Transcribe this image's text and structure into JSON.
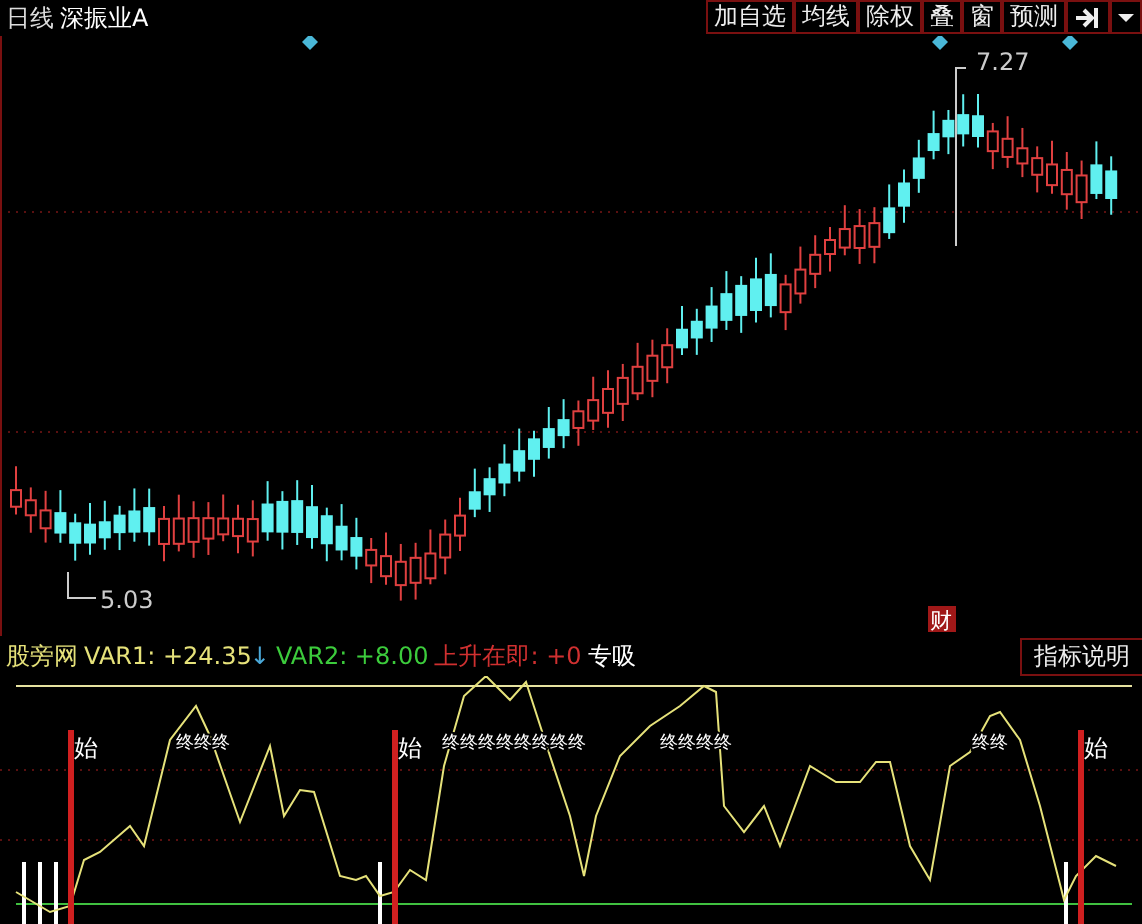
{
  "header": {
    "period": "日线",
    "stock_name": "深振业A"
  },
  "toolbar": [
    {
      "label": "加自选"
    },
    {
      "label": "均线"
    },
    {
      "label": "除权"
    },
    {
      "label": "叠"
    },
    {
      "label": "窗"
    },
    {
      "label": "预测"
    }
  ],
  "price_chart": {
    "high_label": "7.27",
    "low_label": "5.03",
    "event_badge": "财"
  },
  "indicator": {
    "name": "股旁网",
    "explain_button": "指标说明",
    "values": [
      {
        "text": "VAR1: +24.35",
        "color": "#e6e27a"
      },
      {
        "text": "↓",
        "color": "#4aa8d8"
      },
      {
        "text": "VAR2: +8.00",
        "color": "#3ccc3c"
      },
      {
        "text": "上升在即: +0",
        "color": "#d03030"
      },
      {
        "text": "专吸",
        "color": "#ffffff"
      }
    ]
  },
  "signals": [
    {
      "kind": "start",
      "text": "始"
    },
    {
      "kind": "end",
      "text": "终终终"
    },
    {
      "kind": "start",
      "text": "始"
    },
    {
      "kind": "end",
      "text": "终终终终终终终终"
    },
    {
      "kind": "end",
      "text": "终终终终"
    },
    {
      "kind": "end",
      "text": "终终"
    },
    {
      "kind": "start",
      "text": "始"
    }
  ]
}
